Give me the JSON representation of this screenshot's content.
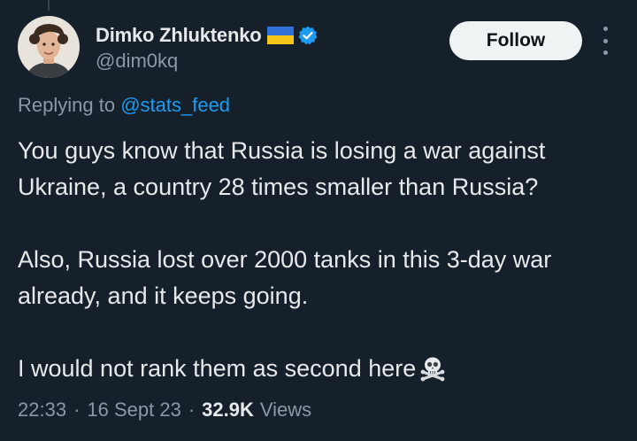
{
  "author": {
    "display_name": "Dimko Zhluktenko",
    "handle": "@dim0kq",
    "flag_icon": "ukraine-flag-icon",
    "verified_icon": "verified-badge-icon",
    "verified_color": "#1d9bf0"
  },
  "actions": {
    "follow_label": "Follow",
    "more_icon": "more-options-icon"
  },
  "reply": {
    "prefix": "Replying to ",
    "mention": "@stats_feed"
  },
  "tweet": {
    "paragraphs": [
      "You guys know that Russia is losing a war against Ukraine, a country 28 times smaller than Russia?",
      "Also, Russia lost over 2000 tanks in this 3-day war already, and it keeps going.",
      "I would not rank them as second here"
    ],
    "emoji": "skull-and-crossbones-icon"
  },
  "meta": {
    "time": "22:33",
    "date": "16 Sept 23",
    "views_count": "32.9K",
    "views_label": "Views",
    "separator": "·"
  },
  "colors": {
    "background": "#15202b",
    "text_primary": "#e7e9ea",
    "text_secondary": "#8b98a5",
    "link": "#1d9bf0",
    "follow_bg": "#eff3f4"
  }
}
